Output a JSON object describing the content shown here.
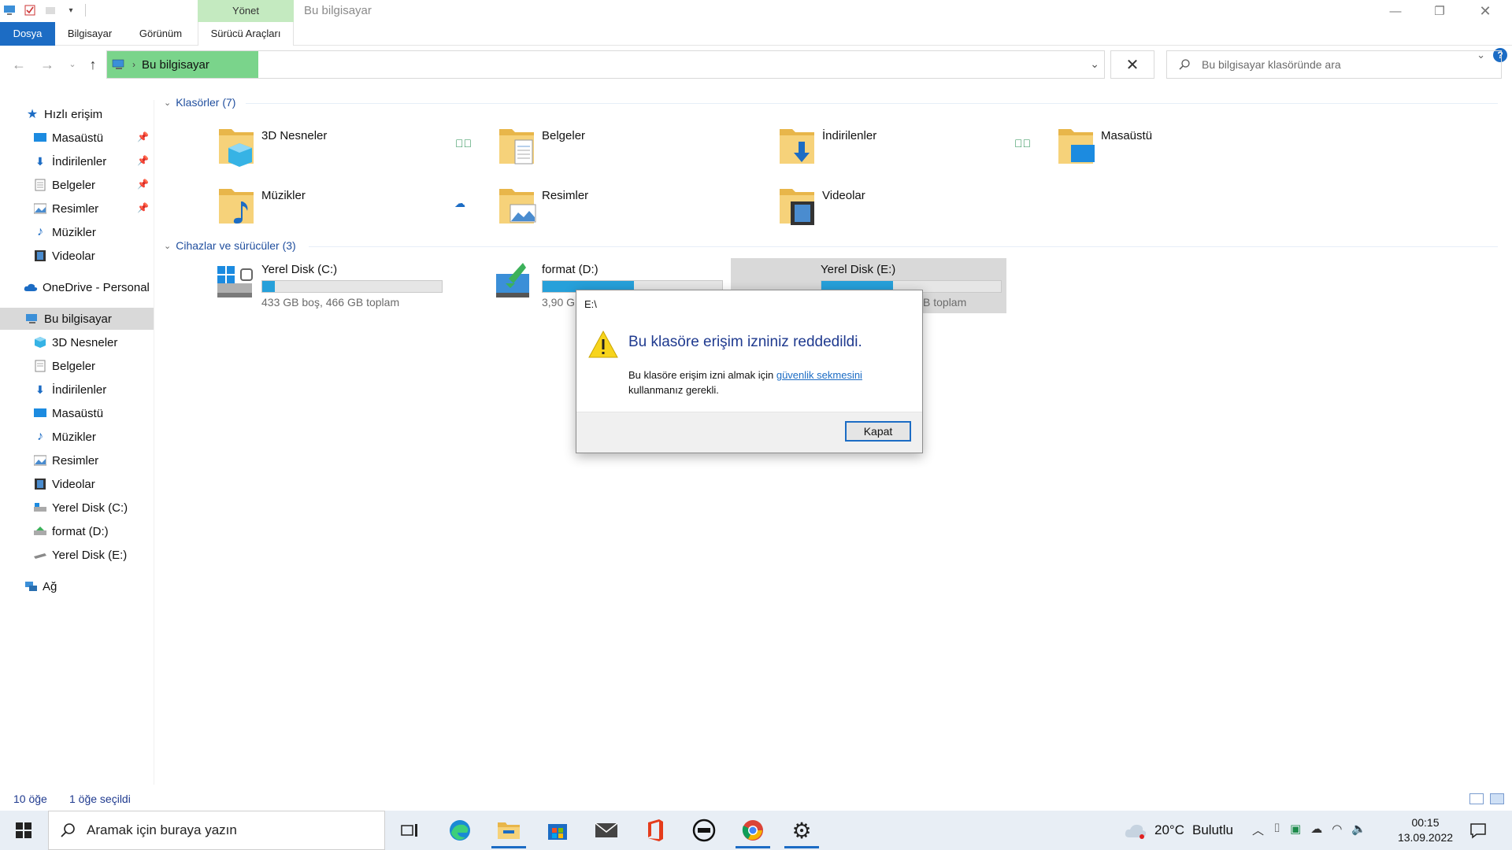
{
  "window": {
    "title": "Bu bilgisayar",
    "contextual_tab_group": "Yönet"
  },
  "ribbon": {
    "tabs": [
      {
        "label": "Dosya"
      },
      {
        "label": "Bilgisayar"
      },
      {
        "label": "Görünüm"
      },
      {
        "label": "Sürücü Araçları"
      }
    ]
  },
  "address": {
    "crumb": "Bu bilgisayar",
    "search_placeholder": "Bu bilgisayar klasöründe ara"
  },
  "sidebar": {
    "quick_access": "Hızlı erişim",
    "quick_items": [
      {
        "label": "Masaüstü",
        "pinned": true
      },
      {
        "label": "İndirilenler",
        "pinned": true
      },
      {
        "label": "Belgeler",
        "pinned": true
      },
      {
        "label": "Resimler",
        "pinned": true
      },
      {
        "label": "Müzikler",
        "pinned": false
      },
      {
        "label": "Videolar",
        "pinned": false
      }
    ],
    "onedrive": "OneDrive - Personal",
    "this_pc": "Bu bilgisayar",
    "pc_items": [
      {
        "label": "3D Nesneler"
      },
      {
        "label": "Belgeler"
      },
      {
        "label": "İndirilenler"
      },
      {
        "label": "Masaüstü"
      },
      {
        "label": "Müzikler"
      },
      {
        "label": "Resimler"
      },
      {
        "label": "Videolar"
      },
      {
        "label": "Yerel Disk (C:)"
      },
      {
        "label": "format (D:)"
      },
      {
        "label": "Yerel Disk (E:)"
      }
    ],
    "network": "Ağ"
  },
  "main": {
    "folders_header": "Klasörler (7)",
    "folders": [
      {
        "name": "3D Nesneler"
      },
      {
        "name": "Belgeler"
      },
      {
        "name": "İndirilenler"
      },
      {
        "name": "Masaüstü"
      },
      {
        "name": "Müzikler"
      },
      {
        "name": "Resimler"
      },
      {
        "name": "Videolar"
      }
    ],
    "devices_header": "Cihazlar ve sürücüler (3)",
    "drives": [
      {
        "name": "Yerel Disk (C:)",
        "info": "433 GB boş, 466 GB toplam",
        "used_fraction": 0.07
      },
      {
        "name": "format (D:)",
        "info": "3,90 G",
        "used_fraction": 0.51
      },
      {
        "name": "Yerel Disk (E:)",
        "info": "B toplam",
        "used_fraction": 0.4
      }
    ]
  },
  "dialog": {
    "title": "E:\\",
    "heading": "Bu klasöre erişim izniniz reddedildi.",
    "body_prefix": "Bu klasöre erişim izni almak için ",
    "link": "güvenlik sekmesini",
    "body_suffix": " kullanmanız gerekli.",
    "close_button": "Kapat"
  },
  "statusbar": {
    "item_count": "10 öğe",
    "selected": "1 öğe seçildi"
  },
  "taskbar": {
    "search_placeholder": "Aramak için buraya yazın",
    "weather_temp": "20°C",
    "weather_desc": "Bulutlu",
    "time": "00:15",
    "date": "13.09.2022"
  },
  "colors": {
    "accent": "#1c6cc4",
    "address_highlight": "#7ad48b",
    "drive_fill": "#26a0da",
    "context_tab": "#c4eac0"
  }
}
